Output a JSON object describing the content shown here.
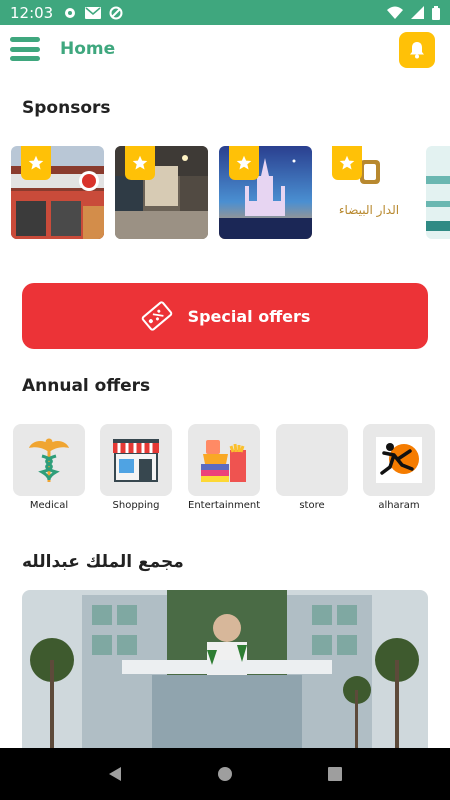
{
  "status": {
    "time": "12:03"
  },
  "header": {
    "title": "Home"
  },
  "sponsors": {
    "title": "Sponsors",
    "logo_text": "الدار البيضاء"
  },
  "special_offers": {
    "label": "Special offers"
  },
  "annual": {
    "title": "Annual offers",
    "categories": [
      {
        "label": "Medical",
        "icon": "caduceus-icon"
      },
      {
        "label": "Shopping",
        "icon": "storefront-icon"
      },
      {
        "label": "Entertainment",
        "icon": "food-stack-icon"
      },
      {
        "label": "store",
        "icon": ""
      },
      {
        "label": "alharam",
        "icon": "runner-logo-icon"
      }
    ]
  },
  "mall": {
    "title": "مجمع الملك عبدالله"
  },
  "colors": {
    "primary": "#3fa77e",
    "accent": "#ffc107",
    "offer": "#ec3337"
  }
}
